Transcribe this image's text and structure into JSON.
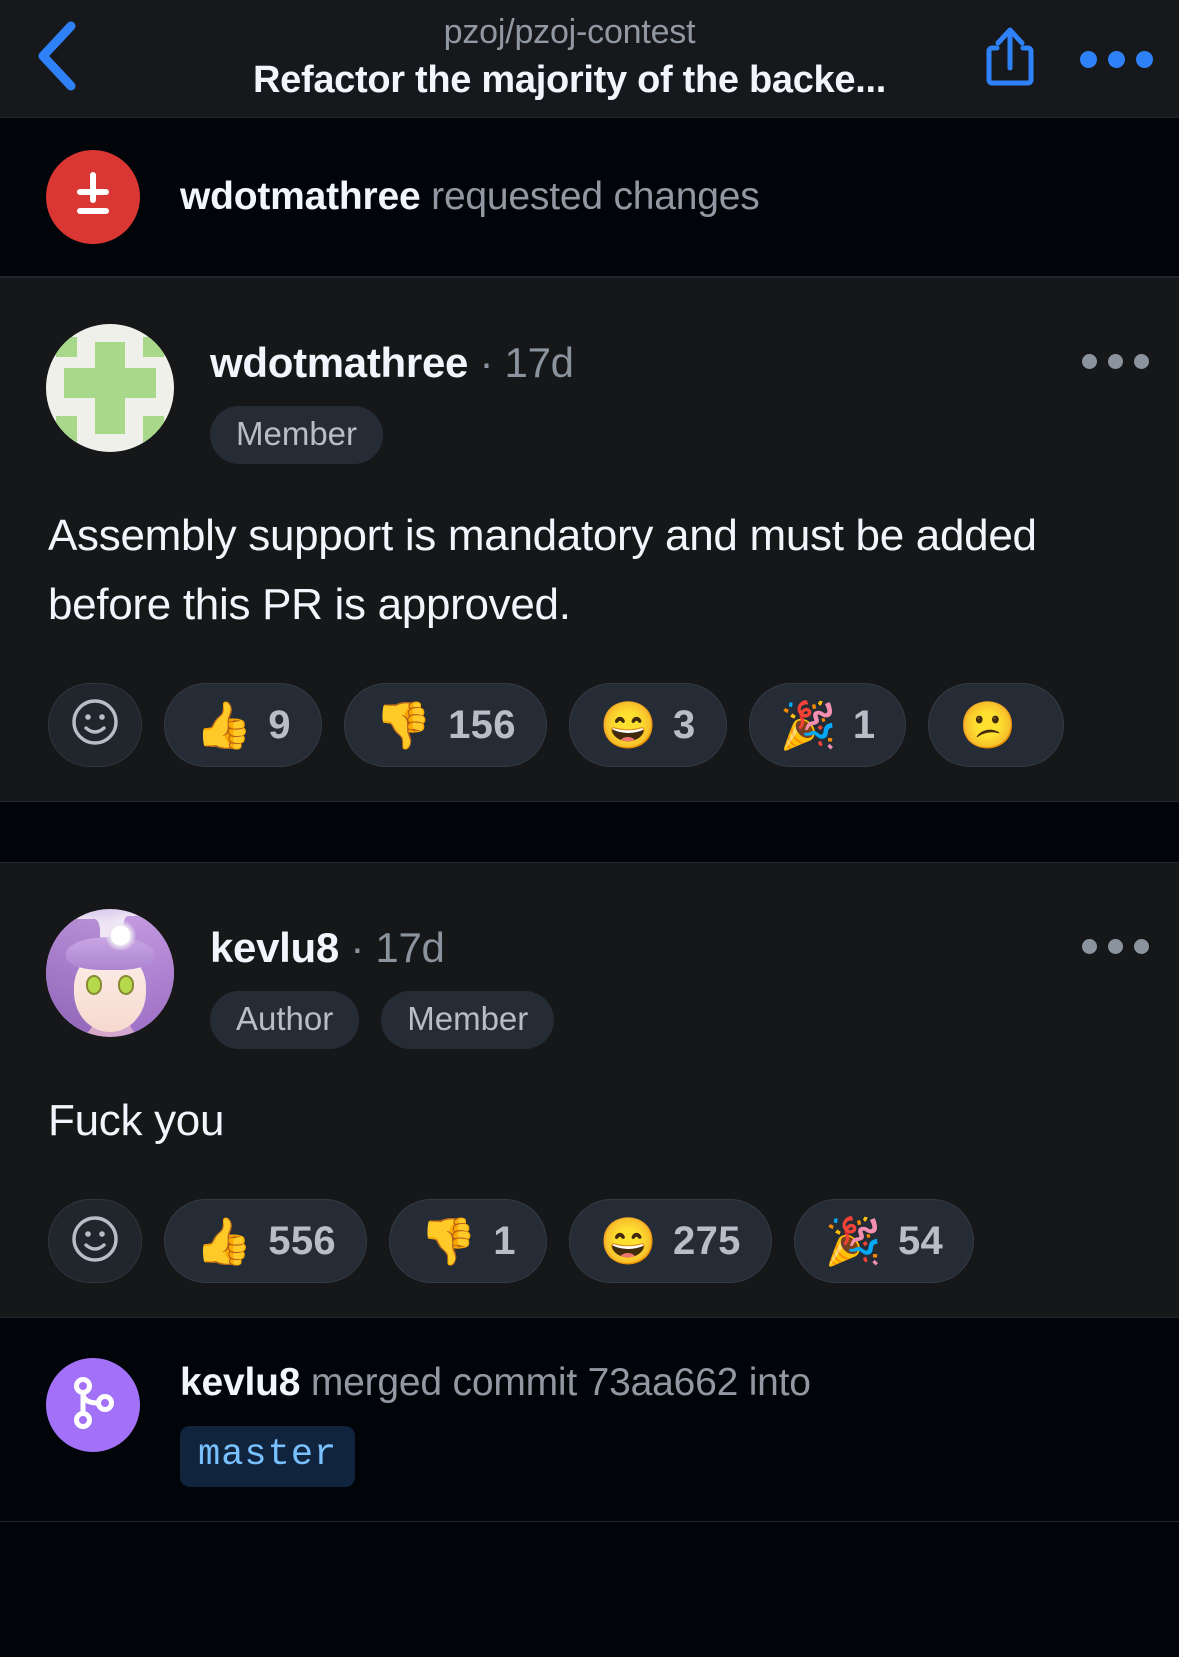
{
  "header": {
    "repo": "pzoj/pzoj-contest",
    "title": "Refactor the majority of the backe...",
    "back_icon": "chevron-left-icon",
    "share_icon": "share-icon",
    "more_icon": "more-horizontal-icon"
  },
  "timeline": {
    "review_event": {
      "icon": "diff-icon",
      "badge_color": "#da3633",
      "user": "wdotmathree",
      "action": "requested changes"
    },
    "comments": [
      {
        "author": "wdotmathree",
        "time": "17d",
        "separator": "·",
        "avatar": "wdotmathree-avatar",
        "chips": [
          "Member"
        ],
        "body": "Assembly support is mandatory and must be added before this PR is approved.",
        "more_icon": "more-horizontal-icon",
        "add_reaction_icon": "smiley-outline-icon",
        "reactions": [
          {
            "emoji": "👍",
            "name": "thumbs-up",
            "count": "9"
          },
          {
            "emoji": "👎",
            "name": "thumbs-down",
            "count": "156"
          },
          {
            "emoji": "😄",
            "name": "laugh",
            "count": "3"
          },
          {
            "emoji": "🎉",
            "name": "hooray",
            "count": "1"
          },
          {
            "emoji": "😕",
            "name": "confused",
            "count": ""
          }
        ]
      },
      {
        "author": "kevlu8",
        "time": "17d",
        "separator": "·",
        "avatar": "kevlu8-avatar",
        "chips": [
          "Author",
          "Member"
        ],
        "body": "Fuck you",
        "more_icon": "more-horizontal-icon",
        "add_reaction_icon": "smiley-outline-icon",
        "reactions": [
          {
            "emoji": "👍",
            "name": "thumbs-up",
            "count": "556"
          },
          {
            "emoji": "👎",
            "name": "thumbs-down",
            "count": "1"
          },
          {
            "emoji": "😄",
            "name": "laugh",
            "count": "275"
          },
          {
            "emoji": "🎉",
            "name": "hooray",
            "count": "54"
          }
        ]
      }
    ],
    "merge_event": {
      "icon": "git-merge-icon",
      "badge_color": "#a371f7",
      "user": "kevlu8",
      "action_before": "merged commit",
      "commit": "73aa662",
      "action_after": "into",
      "branch": "master"
    }
  },
  "colors": {
    "accent": "#2f81f7",
    "danger": "#da3633",
    "merged": "#a371f7",
    "branch_text": "#79c0ff",
    "branch_bg": "#10243d",
    "page_bg": "#010409",
    "card_bg": "#151719"
  }
}
